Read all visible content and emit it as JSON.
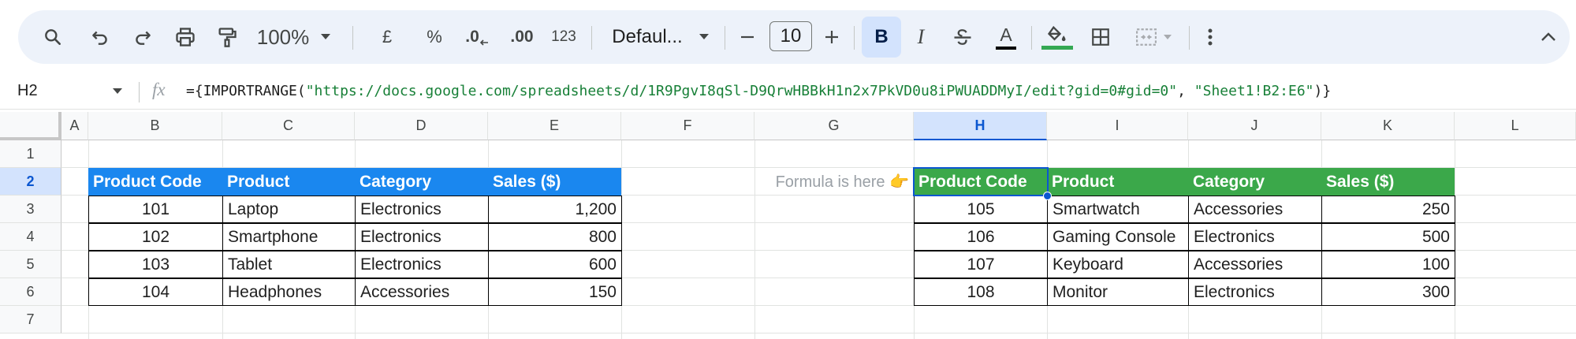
{
  "toolbar": {
    "zoom": "100%",
    "currency": "£",
    "percent": "%",
    "decrease_decimal": ".0",
    "increase_decimal": ".00",
    "number_format": "123",
    "font": "Defaul...",
    "font_size": "10",
    "bold": "B",
    "italic": "I",
    "text_color": "A",
    "fill_color": "#34a853"
  },
  "formula_bar": {
    "name_box": "H2",
    "fx": "fx",
    "formula_prefix": "={IMPORTRANGE(",
    "formula_url": "\"https://docs.google.com/spreadsheets/d/1R9PgvI8qSl-D9QrwHBBkH1n2x7PkVD0u8iPWUADDMyI/edit?gid=0#gid=0\"",
    "formula_sep": ", ",
    "formula_range": "\"Sheet1!B2:E6\"",
    "formula_suffix": ")}"
  },
  "columns": [
    "A",
    "B",
    "C",
    "D",
    "E",
    "F",
    "G",
    "H",
    "I",
    "J",
    "K",
    "L"
  ],
  "rows": [
    "1",
    "2",
    "3",
    "4",
    "5",
    "6",
    "7"
  ],
  "note": "Formula is here 👉",
  "source_table": {
    "headers": [
      "Product Code",
      "Product",
      "Category",
      "Sales ($)"
    ],
    "rows": [
      [
        "101",
        "Laptop",
        "Electronics",
        "1,200"
      ],
      [
        "102",
        "Smartphone",
        "Electronics",
        "800"
      ],
      [
        "103",
        "Tablet",
        "Electronics",
        "600"
      ],
      [
        "104",
        "Headphones",
        "Accessories",
        "150"
      ]
    ]
  },
  "imported_table": {
    "headers": [
      "Product Code",
      "Product",
      "Category",
      "Sales ($)"
    ],
    "rows": [
      [
        "105",
        "Smartwatch",
        "Accessories",
        "250"
      ],
      [
        "106",
        "Gaming Console",
        "Electronics",
        "500"
      ],
      [
        "107",
        "Keyboard",
        "Accessories",
        "100"
      ],
      [
        "108",
        "Monitor",
        "Electronics",
        "300"
      ]
    ]
  },
  "colors": {
    "source_header": "#1a87ef",
    "imported_header": "#3ba84a",
    "selection": "#0b57d0"
  }
}
